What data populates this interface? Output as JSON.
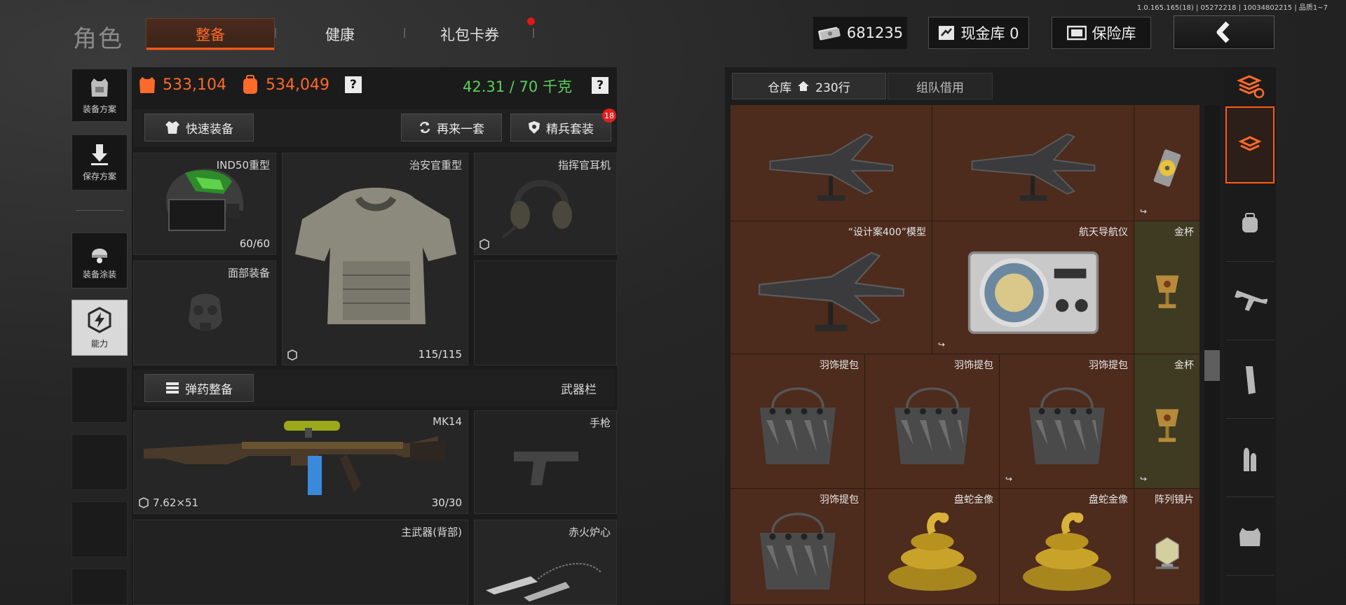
{
  "version": "1.0.165.165(18) | 05272218 | 10034802215 | 品质1~7",
  "title": "角色",
  "tabs": [
    {
      "label": "整备",
      "active": true
    },
    {
      "label": "健康",
      "active": false
    },
    {
      "label": "礼包卡券",
      "active": false,
      "dot": true
    }
  ],
  "currency": {
    "cash_amount": "681235",
    "cash_vault_label": "现金库 0",
    "safe_label": "保险库"
  },
  "sidebar": [
    {
      "label": "装备方案",
      "icon": "vest-icon"
    },
    {
      "label": "保存方案",
      "icon": "download-icon"
    },
    {
      "label": "装备涂装",
      "icon": "helmet-paint-icon"
    },
    {
      "label": "能力",
      "icon": "ability-icon",
      "active": true
    }
  ],
  "stats": {
    "value1": "533,104",
    "value2": "534,049",
    "weight": "42.31 / 70 千克",
    "help": "?"
  },
  "buttons": {
    "quick_equip": "快速装备",
    "again": "再来一套",
    "elite": "精兵套装",
    "elite_badge": "18",
    "ammo": "弹药整备"
  },
  "slots": {
    "helmet": {
      "label": "IND50重型",
      "count": "60/60"
    },
    "armor": {
      "label": "治安官重型",
      "count": "115/115"
    },
    "headset": {
      "label": "指挥官耳机"
    },
    "face": {
      "label": "面部装备"
    },
    "weapon_header": "武器栏",
    "primary": {
      "label": "MK14",
      "ammo": "7.62×51",
      "count": "30/30"
    },
    "pistol": {
      "label": "手枪"
    },
    "primary_back": {
      "label": "主武器(背部)"
    },
    "melee": {
      "label": "赤火炉心"
    }
  },
  "warehouse": {
    "tab_active": "仓库",
    "tab_count": "230行",
    "tab_team": "组队借用",
    "items": [
      {
        "label": "",
        "kind": "plane"
      },
      {
        "label": "",
        "kind": "plane"
      },
      {
        "label": "",
        "kind": "disc"
      },
      {
        "label": "“设计案400”模型",
        "kind": "plane"
      },
      {
        "label": "航天导航仪",
        "kind": "navigator"
      },
      {
        "label": "金杯",
        "kind": "cup"
      },
      {
        "label": "羽饰提包",
        "kind": "bag"
      },
      {
        "label": "羽饰提包",
        "kind": "bag"
      },
      {
        "label": "羽饰提包",
        "kind": "bag"
      },
      {
        "label": "金杯",
        "kind": "cup"
      },
      {
        "label": "羽饰提包",
        "kind": "bag"
      },
      {
        "label": "盘蛇金像",
        "kind": "snake"
      },
      {
        "label": "盘蛇金像",
        "kind": "snake"
      },
      {
        "label": "阵列镜片",
        "kind": "lens"
      }
    ]
  },
  "categories": [
    "all-icon",
    "backpack-icon",
    "rifle-icon",
    "magazine-icon",
    "ammo-icon",
    "armor-icon"
  ]
}
